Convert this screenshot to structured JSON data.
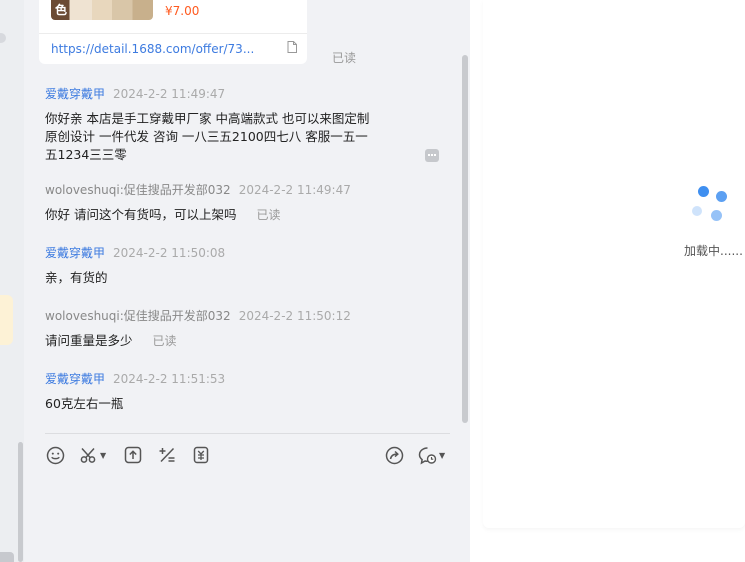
{
  "product_card": {
    "thumb_text": "色",
    "price": "¥7.00",
    "link": "https://detail.1688.com/offer/73...",
    "read_status": "已读"
  },
  "messages": [
    {
      "sender": "爱戴穿戴甲",
      "time": "2024-2-2 11:49:47",
      "text": "你好亲 本店是手工穿戴甲厂家 中高端款式 也可以来图定制 原创设计 一件代发 咨询 一八三五2100四七八 客服一五一五1234三三零"
    },
    {
      "sender": "woloveshuqi:促佳搜品开发部032",
      "time": "2024-2-2 11:49:47",
      "text": "你好 请问这个有货吗，可以上架吗",
      "read_status": "已读"
    },
    {
      "sender": "爱戴穿戴甲",
      "time": "2024-2-2 11:50:08",
      "text": "亲，有货的"
    },
    {
      "sender": "woloveshuqi:促佳搜品开发部032",
      "time": "2024-2-2 11:50:12",
      "text": "请问重量是多少",
      "read_status": "已读"
    },
    {
      "sender": "爱戴穿戴甲",
      "time": "2024-2-2 11:51:53",
      "text": "60克左右一瓶"
    }
  ],
  "toolbar": {
    "icons": [
      "emoji-icon",
      "scissors-icon",
      "upload-icon",
      "calculator-icon",
      "coupon-icon",
      "share-icon",
      "quick-reply-icon"
    ]
  },
  "right_panel": {
    "loading_text": "加载中......"
  },
  "colors": {
    "seller": "#3d7be0",
    "buyer": "#888888",
    "price": "#ff5a1f",
    "spinner": "#3f8ff0"
  }
}
